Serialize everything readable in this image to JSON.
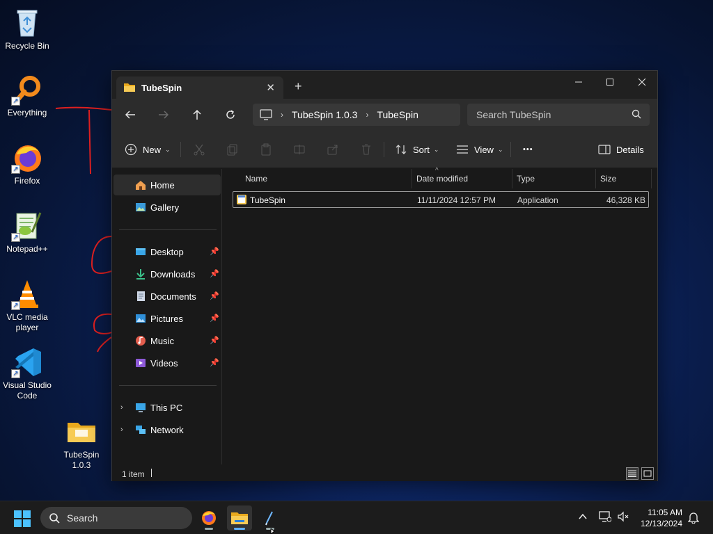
{
  "desktop": {
    "icons": [
      {
        "label": "Recycle Bin",
        "icon": "recycle-bin-icon"
      },
      {
        "label": "Everything",
        "icon": "everything-search-icon"
      },
      {
        "label": "Firefox",
        "icon": "firefox-icon"
      },
      {
        "label": "Notepad++",
        "icon": "notepad-plus-plus-icon"
      },
      {
        "label": "VLC media player",
        "icon": "vlc-icon"
      },
      {
        "label": "Visual Studio Code",
        "icon": "vscode-icon"
      },
      {
        "label": "TubeSpin 1.0.3",
        "icon": "folder-icon"
      }
    ]
  },
  "explorer": {
    "tab_title": "TubeSpin",
    "breadcrumb": [
      "TubeSpin 1.0.3",
      "TubeSpin"
    ],
    "search_placeholder": "Search TubeSpin",
    "toolbar": {
      "new": "New",
      "sort": "Sort",
      "view": "View",
      "more": "•••",
      "details": "Details"
    },
    "sidebar": {
      "home": "Home",
      "gallery": "Gallery",
      "pinned": [
        "Desktop",
        "Downloads",
        "Documents",
        "Pictures",
        "Music",
        "Videos"
      ],
      "this_pc": "This PC",
      "network": "Network"
    },
    "columns": {
      "name": "Name",
      "date": "Date modified",
      "type": "Type",
      "size": "Size"
    },
    "files": [
      {
        "name": "TubeSpin",
        "date": "11/11/2024 12:57 PM",
        "type": "Application",
        "size": "46,328 KB"
      }
    ],
    "status": "1 item"
  },
  "taskbar": {
    "search_label": "Search",
    "time": "11:05 AM",
    "date": "12/13/2024"
  },
  "colors": {
    "accent": "#5fb2ff",
    "folder": "#f3c24a",
    "window_bg": "#191919",
    "toolbar_bg": "#2c2c2c"
  }
}
